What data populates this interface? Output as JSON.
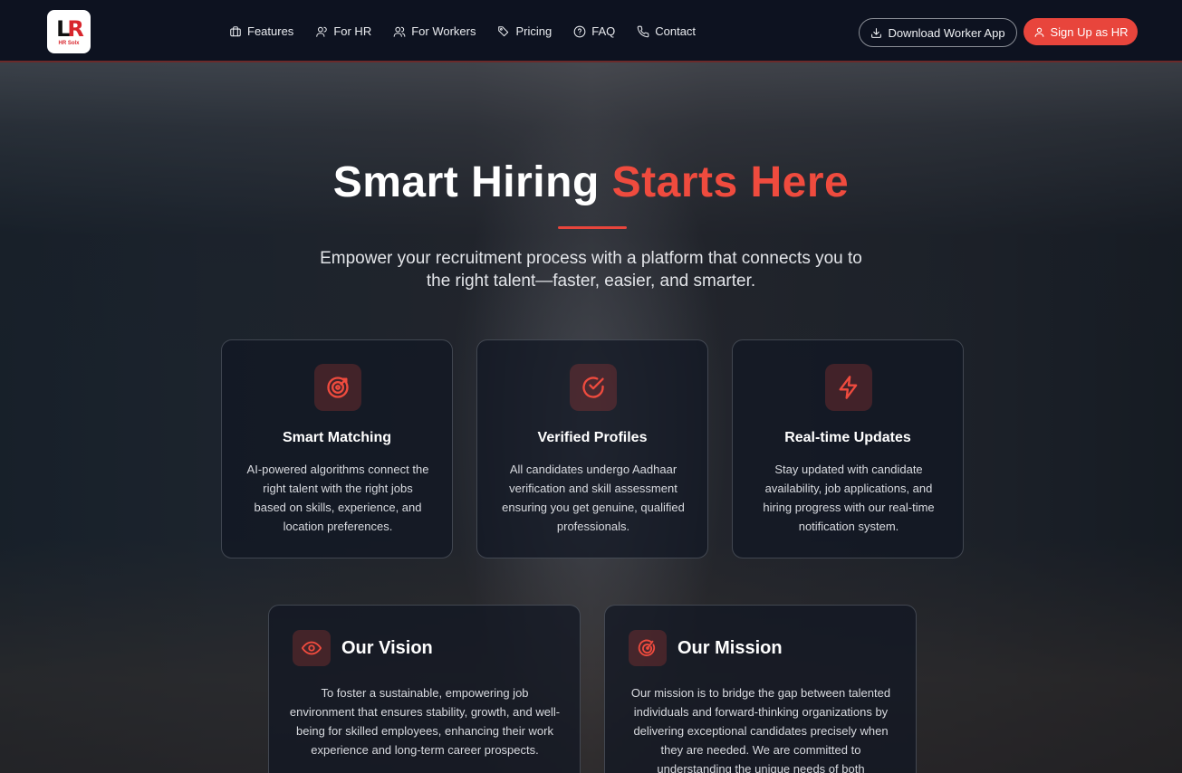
{
  "brand": {
    "logo_sub": "HR Solx"
  },
  "nav": {
    "links": [
      {
        "label": "Features",
        "icon": "briefcase-icon"
      },
      {
        "label": "For HR",
        "icon": "user-icon"
      },
      {
        "label": "For Workers",
        "icon": "users-icon"
      },
      {
        "label": "Pricing",
        "icon": "tag-icon"
      },
      {
        "label": "FAQ",
        "icon": "help-circle-icon"
      },
      {
        "label": "Contact",
        "icon": "phone-icon"
      }
    ],
    "download_label": "Download Worker App",
    "signup_label": "Sign Up as HR"
  },
  "hero": {
    "title_main": "Smart Hiring",
    "title_accent": "Starts Here",
    "subtitle": "Empower your recruitment process with a platform that connects you to the right talent—faster, easier, and smarter."
  },
  "features": [
    {
      "title": "Smart Matching",
      "text": "AI-powered algorithms connect the right talent with the right jobs based on skills, experience, and location preferences.",
      "icon": "target-icon"
    },
    {
      "title": "Verified Profiles",
      "text": "All candidates undergo Aadhaar verification and skill assessment ensuring you get genuine, qualified professionals.",
      "icon": "check-circle-icon"
    },
    {
      "title": "Real-time Updates",
      "text": "Stay updated with candidate availability, job applications, and hiring progress with our real-time notification system.",
      "icon": "lightning-icon"
    }
  ],
  "vision": {
    "title": "Our Vision",
    "text": "To foster a sustainable, empowering job environment that ensures stability, growth, and well-being for skilled employees, enhancing their work experience and long-term career prospects.",
    "icon": "eye-icon"
  },
  "mission": {
    "title": "Our Mission",
    "text": "Our mission is to bridge the gap between talented individuals and forward-thinking organizations by delivering exceptional candidates precisely when they are needed. We are committed to understanding the unique needs of both",
    "icon": "radar-icon"
  },
  "colors": {
    "accent": "#e8453c",
    "nav_bg": "#0d1220"
  }
}
